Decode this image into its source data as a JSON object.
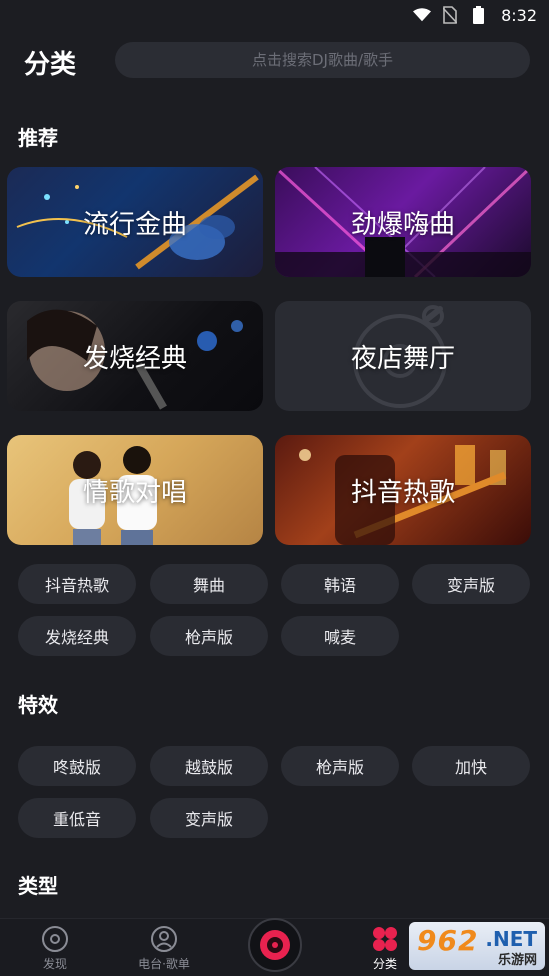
{
  "status_bar": {
    "time": "8:32",
    "icons": [
      "wifi-icon",
      "no-sim-icon",
      "battery-icon"
    ]
  },
  "header": {
    "title": "分类",
    "search_placeholder": "点击搜索DJ歌曲/歌手"
  },
  "sections": {
    "recommend": "推荐",
    "effects": "特效",
    "types": "类型"
  },
  "cards": [
    {
      "label": "流行金曲",
      "icon": "guitar-art"
    },
    {
      "label": "劲爆嗨曲",
      "icon": "concert-art"
    },
    {
      "label": "发烧经典",
      "icon": "singer-art"
    },
    {
      "label": "夜店舞厅",
      "icon": "disc-art"
    },
    {
      "label": "情歌对唱",
      "icon": "duet-art"
    },
    {
      "label": "抖音热歌",
      "icon": "stage-guitar-art"
    }
  ],
  "recommend_tags": [
    "抖音热歌",
    "舞曲",
    "韩语",
    "变声版",
    "发烧经典",
    "枪声版",
    "喊麦"
  ],
  "effect_tags": [
    "咚鼓版",
    "越鼓版",
    "枪声版",
    "加快",
    "重低音",
    "变声版"
  ],
  "bottom_nav": {
    "discover": "发现",
    "radio": "电台·歌单",
    "category": "分类",
    "active": "category"
  },
  "watermark": {
    "number": "962",
    "net": ".NET",
    "text": "乐游网"
  },
  "colors": {
    "background": "#1c1d22",
    "chip": "#2a2c33",
    "accent": "#e8224f"
  }
}
